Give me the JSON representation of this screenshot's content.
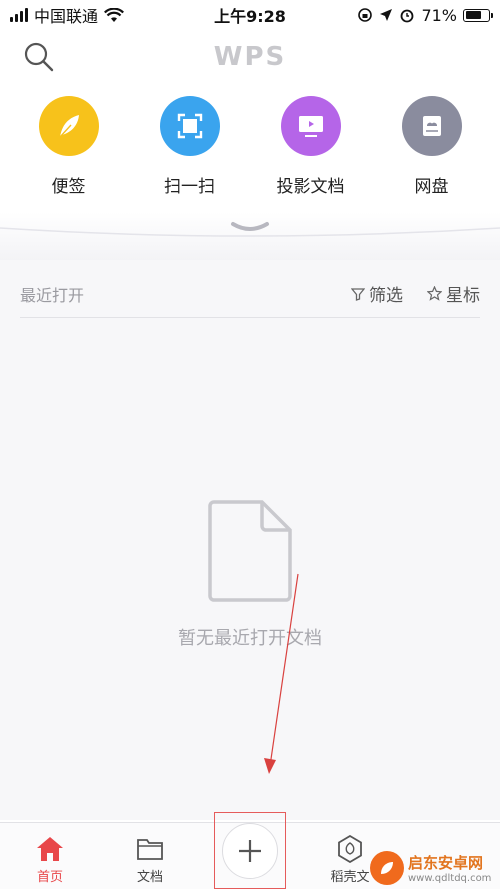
{
  "status_bar": {
    "carrier": "中国联通",
    "time": "上午9:28",
    "battery": "71%",
    "battery_level": 0.71
  },
  "header": {
    "logo": "WPS"
  },
  "quick_actions": [
    {
      "label": "便签",
      "icon": "feather-icon",
      "color": "#f7c21b"
    },
    {
      "label": "扫一扫",
      "icon": "scan-icon",
      "color": "#3aa4ee"
    },
    {
      "label": "投影文档",
      "icon": "projection-icon",
      "color": "#b565e8"
    },
    {
      "label": "网盘",
      "icon": "cloud-disk-icon",
      "color": "#8a8c9e"
    }
  ],
  "recent": {
    "title": "最近打开",
    "filter": "筛选",
    "star": "星标",
    "empty_text": "暂无最近打开文档"
  },
  "tabbar": {
    "home": "首页",
    "docs": "文档",
    "daoke": "稻壳文",
    "accent": "#e8474a"
  },
  "watermark": {
    "title": "启东安卓网",
    "url": "www.qdltdq.com"
  }
}
